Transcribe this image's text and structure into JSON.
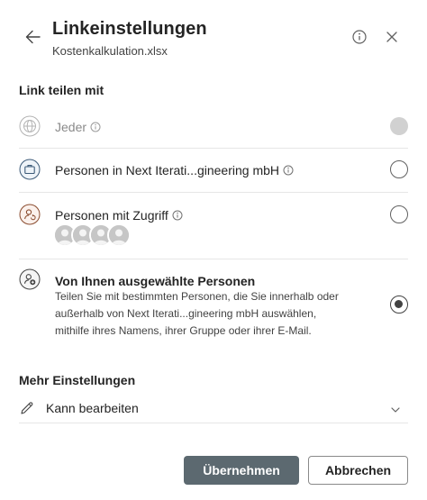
{
  "header": {
    "title": "Linkeinstellungen",
    "filename": "Kostenkalkulation.xlsx"
  },
  "share_section": {
    "title": "Link teilen mit",
    "options": [
      {
        "label": "Jeder",
        "state": "disabled",
        "icon": "globe-icon"
      },
      {
        "label": "Personen in Next Iterati...gineering mbH",
        "state": "unselected",
        "icon": "briefcase-icon"
      },
      {
        "label": "Personen mit Zugriff",
        "state": "unselected",
        "icon": "person-sync-icon"
      },
      {
        "label": "Von Ihnen ausgewählte Personen",
        "state": "selected",
        "icon": "person-add-icon",
        "description_lines": [
          "Teilen Sie mit bestimmten Personen, die Sie innerhalb oder",
          "außerhalb von Next Iterati...gineering mbH auswählen,",
          "mithilfe ihres Namens, ihrer Gruppe oder ihrer E-Mail."
        ]
      }
    ]
  },
  "more_settings": {
    "title": "Mehr Einstellungen",
    "permission": "Kann bearbeiten"
  },
  "footer": {
    "apply_label": "Übernehmen",
    "cancel_label": "Abbrechen"
  },
  "colors": {
    "primary_button": "#5c6970",
    "disabled_radio": "#d1d1d1",
    "text": "#242424"
  }
}
